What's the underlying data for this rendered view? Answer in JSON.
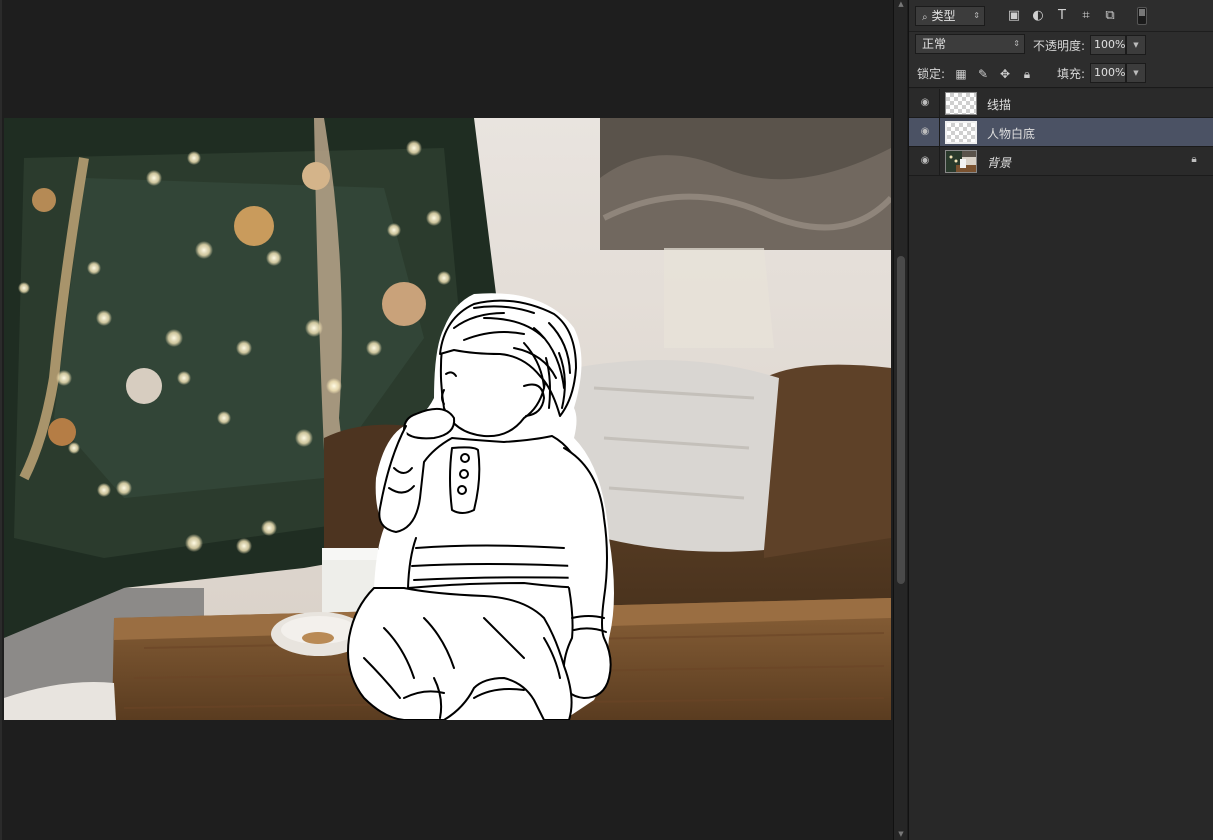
{
  "layers_panel": {
    "filter": {
      "label": "类型",
      "icon": "search-icon"
    },
    "filter_icons": [
      "image-icon",
      "adjustment-icon",
      "type-icon",
      "shape-icon",
      "smart-object-icon"
    ],
    "blend_mode": "正常",
    "opacity_label": "不透明度:",
    "opacity_value": "100%",
    "lock_label": "锁定:",
    "lock_icons": [
      "lock-transparent-icon",
      "lock-paint-icon",
      "lock-move-icon",
      "lock-all-icon"
    ],
    "fill_label": "填充:",
    "fill_value": "100%",
    "layers": [
      {
        "name": "线描",
        "visible": true,
        "selected": false,
        "locked": false
      },
      {
        "name": "人物白底",
        "visible": true,
        "selected": true,
        "locked": false
      },
      {
        "name": "背景",
        "visible": true,
        "selected": false,
        "locked": true
      }
    ]
  },
  "canvas": {
    "content": "photo-with-line-drawing-overlay"
  },
  "colors": {
    "selection": "#4b5264",
    "panel_bg": "#282828",
    "workspace_bg": "#1e1e1e"
  }
}
